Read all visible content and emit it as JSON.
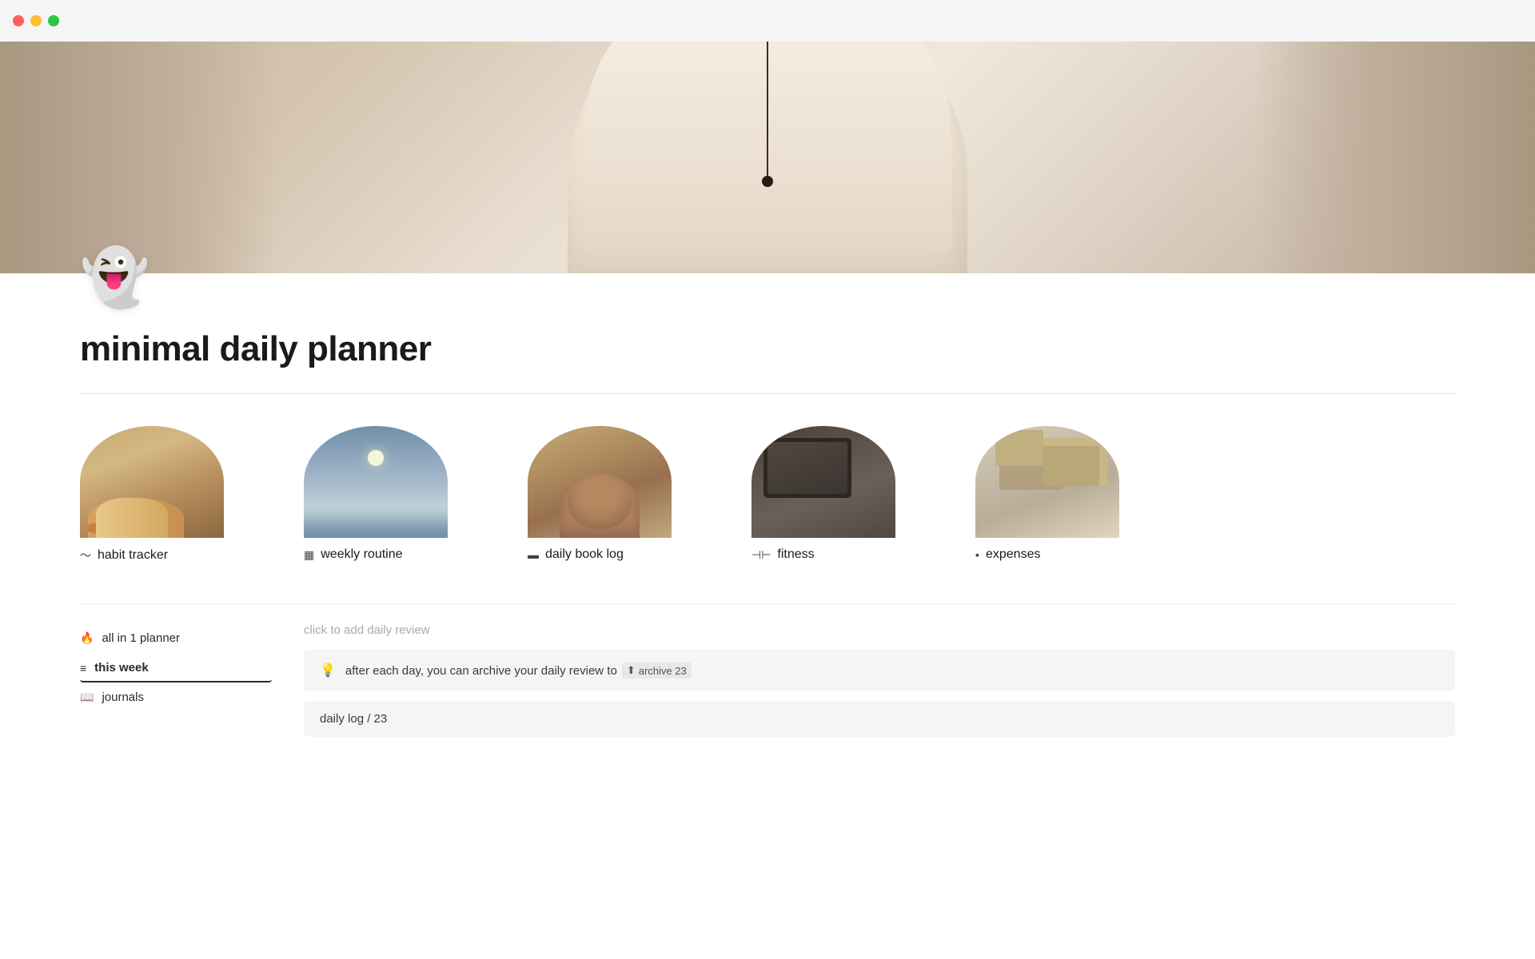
{
  "titlebar": {
    "traffic_lights": [
      "#ff5f57",
      "#febc2e",
      "#28c840"
    ]
  },
  "page": {
    "title": "minimal daily planner",
    "ghost_emoji": "👻"
  },
  "cards": [
    {
      "id": "habit-tracker",
      "label": "habit tracker",
      "icon": "📈",
      "img_class": "card-img-habit"
    },
    {
      "id": "weekly-routine",
      "label": "weekly routine",
      "icon": "📅",
      "img_class": "card-img-weekly"
    },
    {
      "id": "daily-book-log",
      "label": "daily book log",
      "icon": "📓",
      "img_class": "card-img-booklog"
    },
    {
      "id": "fitness",
      "label": "fitness",
      "icon": "🏋",
      "img_class": "card-img-fitness"
    },
    {
      "id": "expenses",
      "label": "expenses",
      "icon": "💰",
      "img_class": "card-img-expenses"
    }
  ],
  "nav": {
    "items": [
      {
        "id": "all-in-1-planner",
        "label": "all in 1 planner",
        "icon": "🔥"
      },
      {
        "id": "this-week",
        "label": "this week",
        "icon": "≡",
        "active": true
      },
      {
        "id": "journals",
        "label": "journals",
        "icon": "📖"
      }
    ]
  },
  "review": {
    "placeholder": "click to add daily review",
    "card1": {
      "icon": "💡",
      "text_prefix": "after each day, you can archive your daily review to",
      "archive_label": "archive 23"
    },
    "card2": {
      "text": "daily log / 23"
    }
  }
}
